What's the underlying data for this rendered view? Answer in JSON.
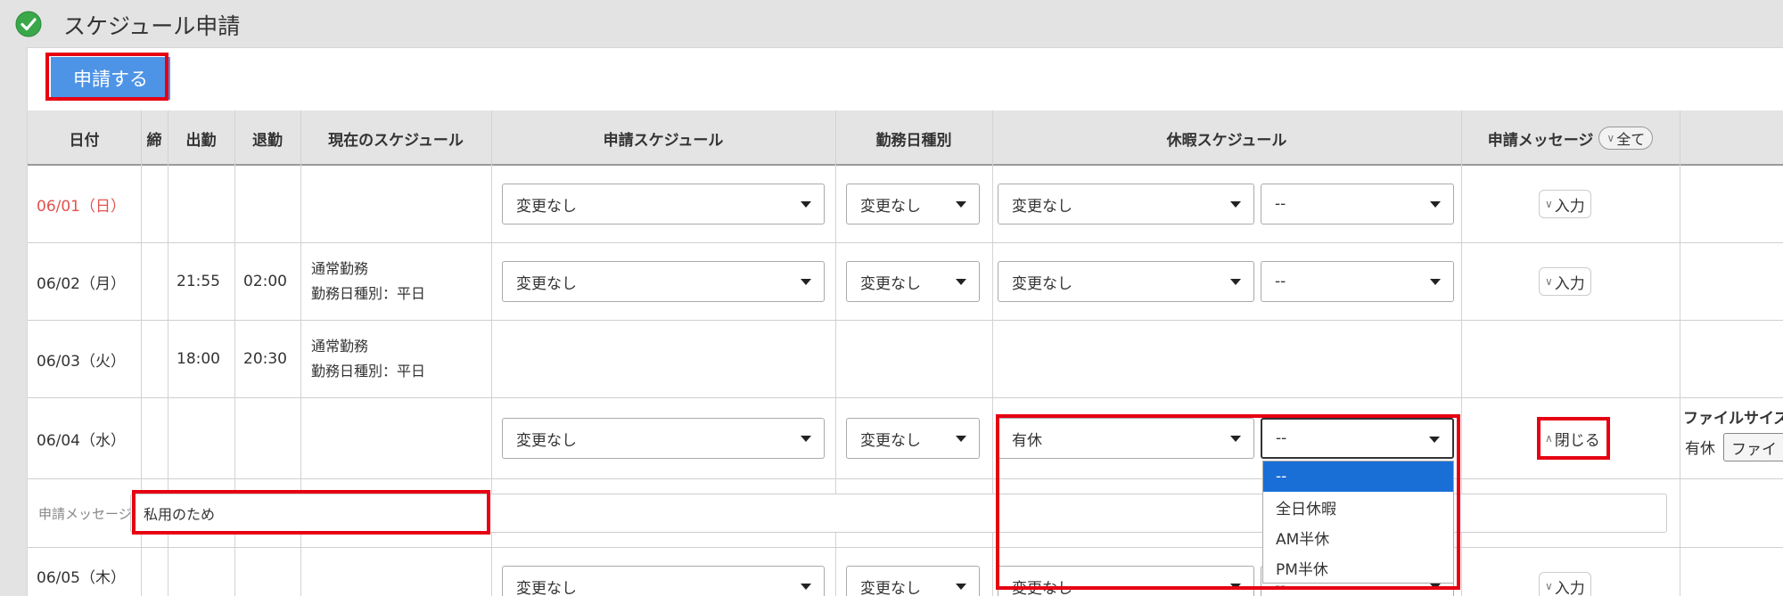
{
  "page": {
    "title": "スケジュール申請"
  },
  "toolbar": {
    "apply_label": "申請する"
  },
  "table": {
    "headers": {
      "date": "日付",
      "close": "締",
      "in": "出勤",
      "out": "退勤",
      "current": "現在のスケジュール",
      "request": "申請スケジュール",
      "daytype": "勤務日種別",
      "leave": "休暇スケジュール",
      "message": "申請メッセージ",
      "all_toggle": "全て"
    },
    "rows": [
      {
        "date": "06/01（日）",
        "in": "",
        "out": "",
        "current1": "",
        "current2": "",
        "request": "変更なし",
        "daytype": "変更なし",
        "leave": "変更なし",
        "leave_sub": "--",
        "msg_btn": "入力"
      },
      {
        "date": "06/02（月）",
        "in": "21:55",
        "out": "02:00",
        "current1": "通常勤務",
        "current2": "勤務日種別：平日",
        "request": "変更なし",
        "daytype": "変更なし",
        "leave": "変更なし",
        "leave_sub": "--",
        "msg_btn": "入力"
      },
      {
        "date": "06/03（火）",
        "in": "18:00",
        "out": "20:30",
        "current1": "通常勤務",
        "current2": "勤務日種別：平日"
      },
      {
        "date": "06/04（水）",
        "in": "",
        "out": "",
        "current1": "",
        "current2": "",
        "request": "変更なし",
        "daytype": "変更なし",
        "leave": "有休",
        "leave_sub": "--",
        "msg_btn": "閉じる"
      },
      {
        "date": "06/05（木）",
        "request": "変更なし",
        "daytype": "変更なし",
        "leave": "変更なし",
        "leave_sub": "--",
        "msg_btn": "入力"
      }
    ],
    "message_row": {
      "label": "申請メッセージ",
      "value": "私用のため"
    },
    "file_panel": {
      "label": "ファイルサイズの",
      "type": "有休",
      "button": "ファイ"
    },
    "leave_dropdown": {
      "options": [
        "--",
        "全日休暇",
        "AM半休",
        "PM半休"
      ],
      "selected": "--"
    }
  },
  "colors": {
    "accent": "#4d94e6",
    "highlight": "#e60012",
    "weekend": "#e0524f"
  }
}
